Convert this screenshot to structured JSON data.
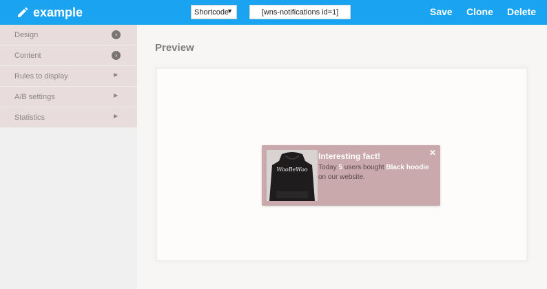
{
  "app": {
    "title": "example",
    "accent_color": "#1aa3f0"
  },
  "toolbar": {
    "type_select_value": "Shortcode",
    "shortcode_value": "[wns-notifications id=1]",
    "save_label": "Save",
    "clone_label": "Clone",
    "delete_label": "Delete"
  },
  "sidebar": {
    "items": [
      {
        "label": "Design",
        "icon": "circle-chevron-right-icon"
      },
      {
        "label": "Content",
        "icon": "circle-chevron-right-icon"
      },
      {
        "label": "Rules to display",
        "icon": "triangle-right-icon"
      },
      {
        "label": "A/B settings",
        "icon": "triangle-right-icon"
      },
      {
        "label": "Statistics",
        "icon": "triangle-right-icon"
      }
    ]
  },
  "preview": {
    "heading": "Preview",
    "popup": {
      "title": "Interesting fact!",
      "text_before": "Today ",
      "count": "5",
      "text_middle": " users bought ",
      "product": "Black hoodie",
      "text_after": "on our website.",
      "image_alt": "Black hoodie with WooBeWoo print",
      "image_print": "WooBeWoo",
      "background_color": "#c9a9ab"
    }
  }
}
